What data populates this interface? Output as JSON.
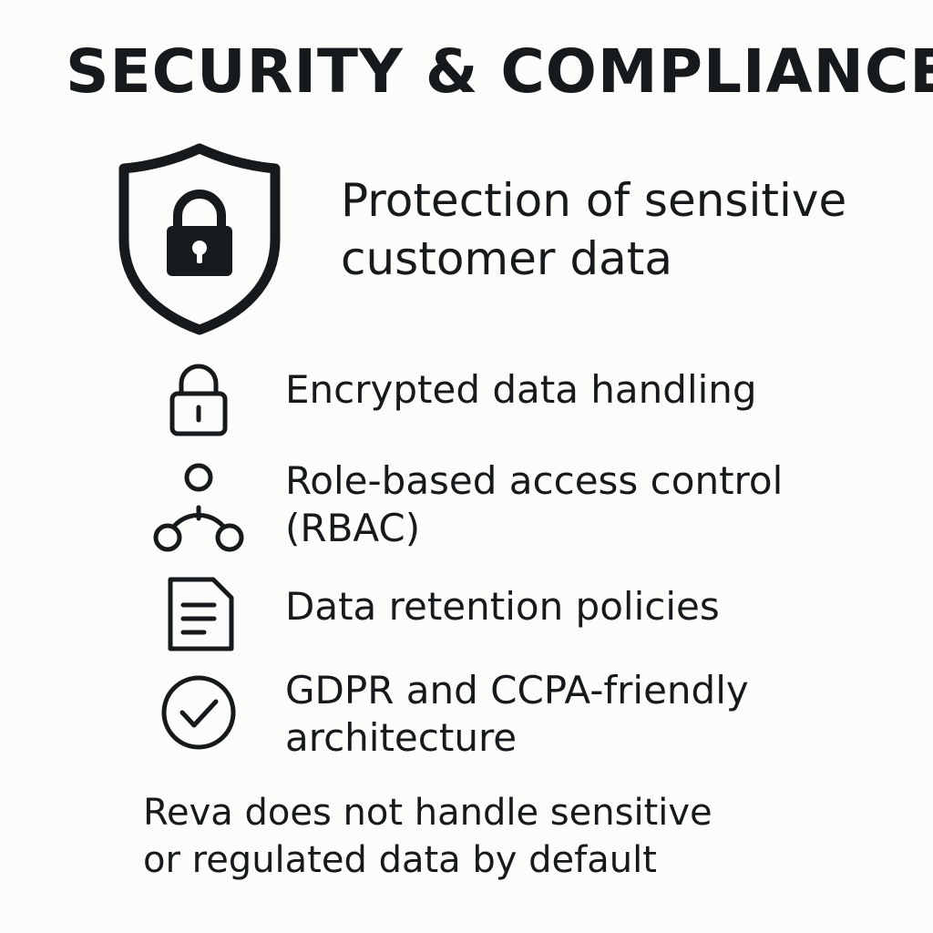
{
  "title": "SECURITY & COMPLIANCE",
  "hero": {
    "icon": "shield-lock-icon",
    "line1": "Protection of sensitive",
    "line2": "customer data"
  },
  "features": [
    {
      "icon": "lock-icon",
      "lines": [
        "Encrypted data handling"
      ]
    },
    {
      "icon": "role-hierarchy-icon",
      "lines": [
        "Role-based access control",
        "(RBAC)"
      ]
    },
    {
      "icon": "document-icon",
      "lines": [
        "Data retention policies"
      ]
    },
    {
      "icon": "check-circle-icon",
      "lines": [
        "GDPR and CCPA-friendly",
        "architecture"
      ]
    }
  ],
  "footer": {
    "line1": "Reva does not handle sensitive",
    "line2": "or regulated data by default"
  },
  "colors": {
    "background": "#fcfcfb",
    "ink": "#161a1c"
  }
}
